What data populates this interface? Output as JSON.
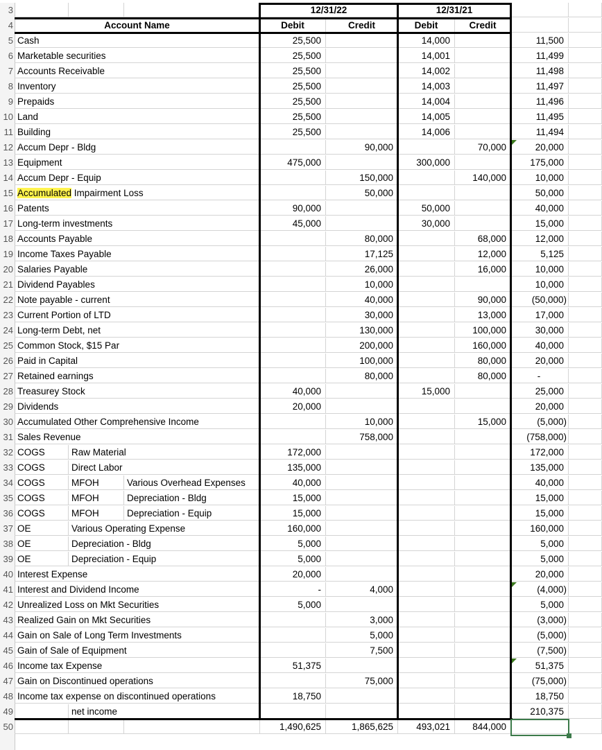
{
  "sheet": {
    "header": {
      "account_name": "Account Name",
      "period_2022": "12/31/22",
      "period_2021": "12/31/21",
      "debit": "Debit",
      "credit": "Credit"
    },
    "row_numbers": [
      "3",
      "4",
      "5",
      "6",
      "7",
      "8",
      "9",
      "10",
      "11",
      "12",
      "13",
      "14",
      "15",
      "16",
      "17",
      "18",
      "19",
      "20",
      "21",
      "22",
      "23",
      "24",
      "25",
      "26",
      "27",
      "28",
      "29",
      "30",
      "31",
      "32",
      "33",
      "34",
      "35",
      "36",
      "37",
      "38",
      "39",
      "40",
      "41",
      "42",
      "43",
      "44",
      "45",
      "46",
      "47",
      "48",
      "49",
      "50"
    ],
    "rows": [
      {
        "a": "Cash",
        "b": "",
        "c": "",
        "d22": "25,500",
        "c22": "",
        "d21": "14,000",
        "c21": "",
        "diff": "11,500"
      },
      {
        "a": "Marketable securities",
        "b": "",
        "c": "",
        "d22": "25,500",
        "c22": "",
        "d21": "14,001",
        "c21": "",
        "diff": "11,499"
      },
      {
        "a": "Accounts Receivable",
        "b": "",
        "c": "",
        "d22": "25,500",
        "c22": "",
        "d21": "14,002",
        "c21": "",
        "diff": "11,498"
      },
      {
        "a": "Inventory",
        "b": "",
        "c": "",
        "d22": "25,500",
        "c22": "",
        "d21": "14,003",
        "c21": "",
        "diff": "11,497"
      },
      {
        "a": "Prepaids",
        "b": "",
        "c": "",
        "d22": "25,500",
        "c22": "",
        "d21": "14,004",
        "c21": "",
        "diff": "11,496"
      },
      {
        "a": "Land",
        "b": "",
        "c": "",
        "d22": "25,500",
        "c22": "",
        "d21": "14,005",
        "c21": "",
        "diff": "11,495"
      },
      {
        "a": "Building",
        "b": "",
        "c": "",
        "d22": "25,500",
        "c22": "",
        "d21": "14,006",
        "c21": "",
        "diff": "11,494"
      },
      {
        "a": "Accum Depr - Bldg",
        "b": "",
        "c": "",
        "d22": "",
        "c22": "90,000",
        "d21": "",
        "c21": "70,000",
        "diff": "20,000",
        "flag": true
      },
      {
        "a": "Equipment",
        "b": "",
        "c": "",
        "d22": "475,000",
        "c22": "",
        "d21": "300,000",
        "c21": "",
        "diff": "175,000"
      },
      {
        "a": "Accum Depr - Equip",
        "b": "",
        "c": "",
        "d22": "",
        "c22": "150,000",
        "d21": "",
        "c21": "140,000",
        "diff": "10,000"
      },
      {
        "a": "Accumulated Impairment Loss",
        "a_hl": "Accumulated",
        "a_rest": " Impairment Loss",
        "b": "",
        "c": "",
        "d22": "",
        "c22": "50,000",
        "d21": "",
        "c21": "",
        "diff": "50,000"
      },
      {
        "a": "Patents",
        "b": "",
        "c": "",
        "d22": "90,000",
        "c22": "",
        "d21": "50,000",
        "c21": "",
        "diff": "40,000"
      },
      {
        "a": "Long-term investments",
        "b": "",
        "c": "",
        "d22": "45,000",
        "c22": "",
        "d21": "30,000",
        "c21": "",
        "diff": "15,000"
      },
      {
        "a": "Accounts Payable",
        "b": "",
        "c": "",
        "d22": "",
        "c22": "80,000",
        "d21": "",
        "c21": "68,000",
        "diff": "12,000"
      },
      {
        "a": "Income Taxes Payable",
        "b": "",
        "c": "",
        "d22": "",
        "c22": "17,125",
        "d21": "",
        "c21": "12,000",
        "diff": "5,125"
      },
      {
        "a": "Salaries Payable",
        "b": "",
        "c": "",
        "d22": "",
        "c22": "26,000",
        "d21": "",
        "c21": "16,000",
        "diff": "10,000"
      },
      {
        "a": "Dividend Payables",
        "b": "",
        "c": "",
        "d22": "",
        "c22": "10,000",
        "d21": "",
        "c21": "",
        "diff": "10,000"
      },
      {
        "a": "Note payable - current",
        "b": "",
        "c": "",
        "d22": "",
        "c22": "40,000",
        "d21": "",
        "c21": "90,000",
        "diff": "(50,000)"
      },
      {
        "a": "Current Portion of LTD",
        "b": "",
        "c": "",
        "d22": "",
        "c22": "30,000",
        "d21": "",
        "c21": "13,000",
        "diff": "17,000"
      },
      {
        "a": "Long-term Debt, net",
        "b": "",
        "c": "",
        "d22": "",
        "c22": "130,000",
        "d21": "",
        "c21": "100,000",
        "diff": "30,000"
      },
      {
        "a": "Common Stock, $15 Par",
        "b": "",
        "c": "",
        "d22": "",
        "c22": "200,000",
        "d21": "",
        "c21": "160,000",
        "diff": "40,000"
      },
      {
        "a": "Paid in Capital",
        "b": "",
        "c": "",
        "d22": "",
        "c22": "100,000",
        "d21": "",
        "c21": "80,000",
        "diff": "20,000"
      },
      {
        "a": "Retained earnings",
        "b": "",
        "c": "",
        "d22": "",
        "c22": "80,000",
        "d21": "",
        "c21": "80,000",
        "diff": "-"
      },
      {
        "a": "Treasurey Stock",
        "b": "",
        "c": "",
        "d22": "40,000",
        "c22": "",
        "d21": "15,000",
        "c21": "",
        "diff": "25,000"
      },
      {
        "a": "Dividends",
        "b": "",
        "c": "",
        "d22": "20,000",
        "c22": "",
        "d21": "",
        "c21": "",
        "diff": "20,000"
      },
      {
        "a": "Accumulated Other Comprehensive Income",
        "b": "",
        "c": "",
        "d22": "",
        "c22": "10,000",
        "d21": "",
        "c21": "15,000",
        "diff": "(5,000)"
      },
      {
        "a": "Sales Revenue",
        "b": "",
        "c": "",
        "d22": "",
        "c22": "758,000",
        "d21": "",
        "c21": "",
        "diff": "(758,000)"
      },
      {
        "a": "COGS",
        "b": "Raw Material",
        "c": "",
        "d22": "172,000",
        "c22": "",
        "d21": "",
        "c21": "",
        "diff": "172,000"
      },
      {
        "a": "COGS",
        "b": "Direct Labor",
        "c": "",
        "d22": "135,000",
        "c22": "",
        "d21": "",
        "c21": "",
        "diff": "135,000"
      },
      {
        "a": "COGS",
        "b": "MFOH",
        "c": "Various Overhead Expenses",
        "d22": "40,000",
        "c22": "",
        "d21": "",
        "c21": "",
        "diff": "40,000"
      },
      {
        "a": "COGS",
        "b": "MFOH",
        "c": "Depreciation - Bldg",
        "d22": "15,000",
        "c22": "",
        "d21": "",
        "c21": "",
        "diff": "15,000"
      },
      {
        "a": "COGS",
        "b": "MFOH",
        "c": "Depreciation - Equip",
        "d22": "15,000",
        "c22": "",
        "d21": "",
        "c21": "",
        "diff": "15,000"
      },
      {
        "a": "OE",
        "b": "Various Operating Expense",
        "c": "",
        "d22": "160,000",
        "c22": "",
        "d21": "",
        "c21": "",
        "diff": "160,000"
      },
      {
        "a": "OE",
        "b": "Depreciation - Bldg",
        "c": "",
        "d22": "5,000",
        "c22": "",
        "d21": "",
        "c21": "",
        "diff": "5,000"
      },
      {
        "a": "OE",
        "b": "Depreciation - Equip",
        "c": "",
        "d22": "5,000",
        "c22": "",
        "d21": "",
        "c21": "",
        "diff": "5,000"
      },
      {
        "a": "Interest Expense",
        "b": "",
        "c": "",
        "d22": "20,000",
        "c22": "",
        "d21": "",
        "c21": "",
        "diff": "20,000"
      },
      {
        "a": "Interest and Dividend Income",
        "b": "",
        "c": "",
        "d22": "-",
        "c22": "4,000",
        "d21": "",
        "c21": "",
        "diff": "(4,000)",
        "flag": true
      },
      {
        "a": "Unrealized Loss on Mkt Securities",
        "b": "",
        "c": "",
        "d22": "5,000",
        "c22": "",
        "d21": "",
        "c21": "",
        "diff": "5,000"
      },
      {
        "a": "Realized Gain on Mkt Securities",
        "b": "",
        "c": "",
        "d22": "",
        "c22": "3,000",
        "d21": "",
        "c21": "",
        "diff": "(3,000)"
      },
      {
        "a": "Gain on Sale of Long Term Investments",
        "b": "",
        "c": "",
        "d22": "",
        "c22": "5,000",
        "d21": "",
        "c21": "",
        "diff": "(5,000)"
      },
      {
        "a": "Gain of Sale of Equipment",
        "b": "",
        "c": "",
        "d22": "",
        "c22": "7,500",
        "d21": "",
        "c21": "",
        "diff": "(7,500)"
      },
      {
        "a": "Income tax Expense",
        "b": "",
        "c": "",
        "d22": "51,375",
        "c22": "",
        "d21": "",
        "c21": "",
        "diff": "51,375",
        "flag": true
      },
      {
        "a": "Gain on Discontinued operations",
        "b": "",
        "c": "",
        "d22": "",
        "c22": "75,000",
        "d21": "",
        "c21": "",
        "diff": "(75,000)"
      },
      {
        "a": "Income tax expense on discontinued operations",
        "b": "",
        "c": "",
        "d22": "18,750",
        "c22": "",
        "d21": "",
        "c21": "",
        "diff": "18,750"
      },
      {
        "a": "",
        "b": "net income",
        "c": "",
        "d22": "",
        "c22": "",
        "d21": "",
        "c21": "",
        "diff": "210,375"
      }
    ],
    "totals": {
      "d22": "1,490,625",
      "c22": "1,865,625",
      "d21": "493,021",
      "c21": "844,000",
      "diff": ""
    }
  }
}
